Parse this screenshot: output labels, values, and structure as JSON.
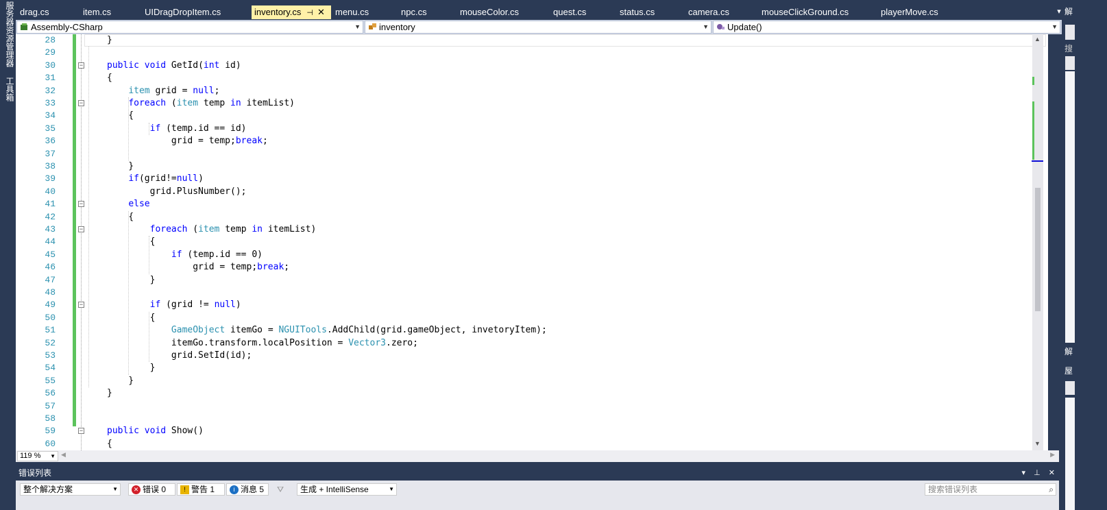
{
  "side_tabs": [
    "服务器资源管理器",
    "工具箱"
  ],
  "tabs": [
    {
      "label": "drag.cs"
    },
    {
      "label": "item.cs"
    },
    {
      "label": "UIDragDropItem.cs"
    },
    {
      "label": "inventory.cs",
      "active": true,
      "pin": "⊣",
      "close": "✕"
    },
    {
      "label": "menu.cs"
    },
    {
      "label": "npc.cs"
    },
    {
      "label": "mouseColor.cs"
    },
    {
      "label": "quest.cs"
    },
    {
      "label": "status.cs"
    },
    {
      "label": "camera.cs"
    },
    {
      "label": "mouseClickGround.cs"
    },
    {
      "label": "playerMove.cs"
    }
  ],
  "tab_menu_icon": "▾",
  "nav": {
    "project": "Assembly-CSharp",
    "class": "inventory",
    "member": "Update()"
  },
  "editor": {
    "line_numbers": [
      "28",
      "29",
      "30",
      "31",
      "32",
      "33",
      "34",
      "35",
      "36",
      "37",
      "38",
      "39",
      "40",
      "41",
      "42",
      "43",
      "44",
      "45",
      "46",
      "47",
      "48",
      "49",
      "50",
      "51",
      "52",
      "53",
      "54",
      "55",
      "56",
      "57",
      "58",
      "59",
      "60"
    ],
    "colors": {
      "keyword": "#0000ff",
      "type": "#2b91af",
      "changed": "#5cc35c",
      "active_tab": "#fff1a8"
    },
    "lines": [
      [
        {
          "t": "}"
        }
      ],
      [],
      [
        {
          "t": "public",
          "k": "kw"
        },
        {
          "t": " "
        },
        {
          "t": "void",
          "k": "kw"
        },
        {
          "t": " GetId("
        },
        {
          "t": "int",
          "k": "kw"
        },
        {
          "t": " id)"
        }
      ],
      [
        {
          "t": "{"
        }
      ],
      [
        {
          "t": "    "
        },
        {
          "t": "item",
          "k": "ty"
        },
        {
          "t": " grid = "
        },
        {
          "t": "null",
          "k": "kw"
        },
        {
          "t": ";"
        }
      ],
      [
        {
          "t": "    "
        },
        {
          "t": "foreach",
          "k": "kw"
        },
        {
          "t": " ("
        },
        {
          "t": "item",
          "k": "ty"
        },
        {
          "t": " temp "
        },
        {
          "t": "in",
          "k": "kw"
        },
        {
          "t": " itemList)"
        }
      ],
      [
        {
          "t": "    {"
        }
      ],
      [
        {
          "t": "        "
        },
        {
          "t": "if",
          "k": "kw"
        },
        {
          "t": " (temp.id == id)"
        }
      ],
      [
        {
          "t": "            grid = temp;"
        },
        {
          "t": "break",
          "k": "kw"
        },
        {
          "t": ";"
        }
      ],
      [],
      [
        {
          "t": "    }"
        }
      ],
      [
        {
          "t": "    "
        },
        {
          "t": "if",
          "k": "kw"
        },
        {
          "t": "(grid!="
        },
        {
          "t": "null",
          "k": "kw"
        },
        {
          "t": ")"
        }
      ],
      [
        {
          "t": "        grid.PlusNumber();"
        }
      ],
      [
        {
          "t": "    "
        },
        {
          "t": "else",
          "k": "kw"
        }
      ],
      [
        {
          "t": "    {"
        }
      ],
      [
        {
          "t": "        "
        },
        {
          "t": "foreach",
          "k": "kw"
        },
        {
          "t": " ("
        },
        {
          "t": "item",
          "k": "ty"
        },
        {
          "t": " temp "
        },
        {
          "t": "in",
          "k": "kw"
        },
        {
          "t": " itemList)"
        }
      ],
      [
        {
          "t": "        {"
        }
      ],
      [
        {
          "t": "            "
        },
        {
          "t": "if",
          "k": "kw"
        },
        {
          "t": " (temp.id == 0)"
        }
      ],
      [
        {
          "t": "                grid = temp;"
        },
        {
          "t": "break",
          "k": "kw"
        },
        {
          "t": ";"
        }
      ],
      [
        {
          "t": "        }"
        }
      ],
      [],
      [
        {
          "t": "        "
        },
        {
          "t": "if",
          "k": "kw"
        },
        {
          "t": " (grid != "
        },
        {
          "t": "null",
          "k": "kw"
        },
        {
          "t": ")"
        }
      ],
      [
        {
          "t": "        {"
        }
      ],
      [
        {
          "t": "            "
        },
        {
          "t": "GameObject",
          "k": "ty"
        },
        {
          "t": " itemGo = "
        },
        {
          "t": "NGUITools",
          "k": "ty"
        },
        {
          "t": ".AddChild(grid.gameObject, invetoryItem);"
        }
      ],
      [
        {
          "t": "            itemGo.transform.localPosition = "
        },
        {
          "t": "Vector3",
          "k": "ty"
        },
        {
          "t": ".zero;"
        }
      ],
      [
        {
          "t": "            grid.SetId(id);"
        }
      ],
      [
        {
          "t": "        }"
        }
      ],
      [
        {
          "t": "    }"
        }
      ],
      [
        {
          "t": "}"
        }
      ],
      [],
      [],
      [
        {
          "t": "public",
          "k": "kw"
        },
        {
          "t": " "
        },
        {
          "t": "void",
          "k": "kw"
        },
        {
          "t": " Show()"
        }
      ],
      [
        {
          "t": "{"
        }
      ]
    ],
    "fold_line_indexes": [
      2,
      5,
      13,
      15,
      21,
      31
    ]
  },
  "zoom": "119 %",
  "error_list": {
    "title": "错误列表",
    "scope": "整个解决方案",
    "errors": "错误 0",
    "warnings": "警告 1",
    "messages": "消息 5",
    "build_filter": "生成 + IntelliSense",
    "search_placeholder": "搜索错误列表"
  },
  "right_panel": {
    "labels": [
      "解",
      "搜",
      "解",
      "屋"
    ]
  }
}
